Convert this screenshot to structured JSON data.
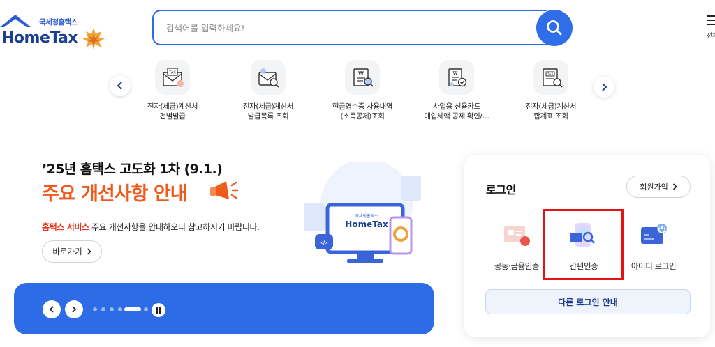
{
  "header": {
    "logo_sub": "국세청홈택스",
    "logo_main": "HomeTax",
    "search_placeholder": "검색어를 입력하세요!",
    "menu_label": "전체메뉴"
  },
  "quick_menu": {
    "items": [
      {
        "label": "전자(세금)계산서\n건별발급",
        "icon": "tax-envelope-icon"
      },
      {
        "label": "전자(세금)계산서\n발급목록 조회",
        "icon": "tax-search-icon"
      },
      {
        "label": "현금영수증 사용내역\n(소득공제)조회",
        "icon": "cash-receipt-icon"
      },
      {
        "label": "사업용 신용카드\n매입세액 공제 확인/…",
        "icon": "card-check-icon"
      },
      {
        "label": "전자(세금)계산서\n합계표 조회",
        "icon": "tax-summary-icon"
      }
    ]
  },
  "banner": {
    "title1": "’25년 홈택스 고도화 1차 (9.1.)",
    "title2": "주요 개선사항 안내",
    "desc_highlight": "홈택스 서비스",
    "desc_rest": " 주요 개선사항을 안내하오니 참고하시기 바랍니다.",
    "goto_label": "바로가기",
    "illus_logo_sub": "국세청홈택스",
    "illus_logo_main": "HomeTax",
    "slide_count": 6,
    "active_slide": 5
  },
  "login": {
    "title": "로그인",
    "join_label": "회원가입",
    "options": [
      {
        "label": "공동·금융인증",
        "icon": "certificate-icon"
      },
      {
        "label": "간편인증",
        "icon": "simple-auth-icon"
      },
      {
        "label": "아이디 로그인",
        "icon": "id-login-icon"
      }
    ],
    "other_label": "다른 로그인 안내"
  },
  "colors": {
    "brand_blue": "#2e6be6",
    "logo_navy": "#1c3f94",
    "accent_orange": "#f05a1a",
    "highlight_red": "#e31414"
  }
}
